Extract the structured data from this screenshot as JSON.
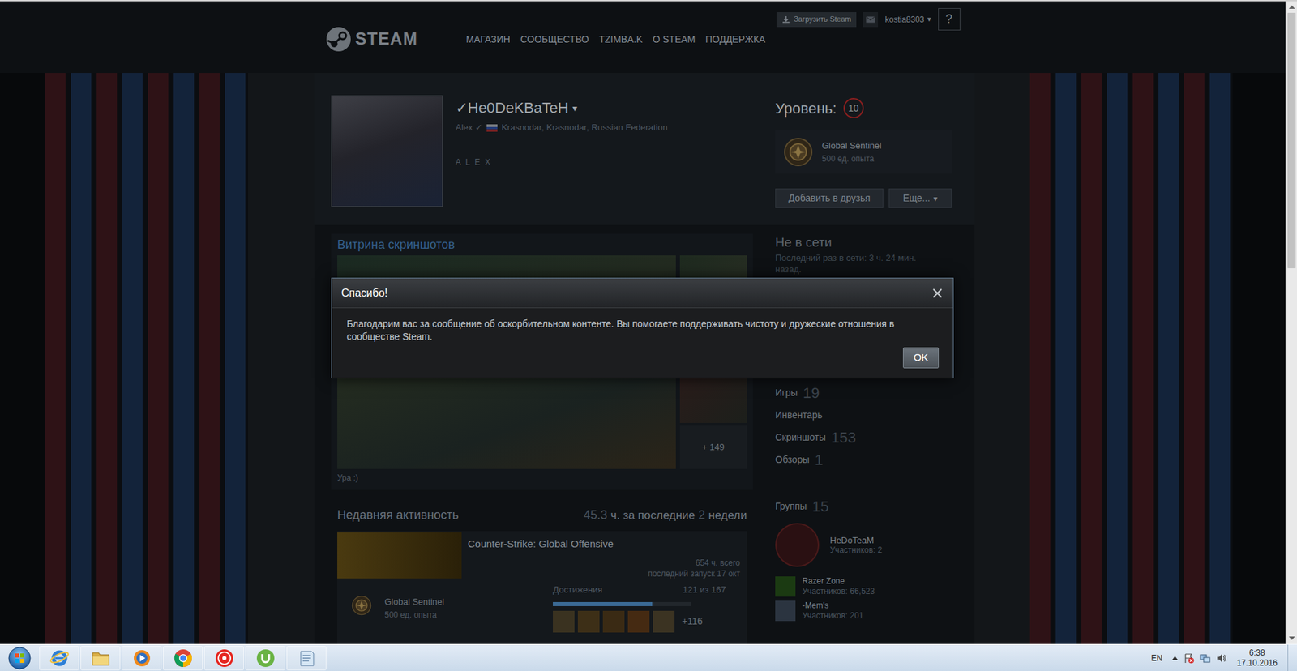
{
  "header": {
    "logo_text": "STEAM",
    "nav": [
      {
        "label": "МАГАЗИН"
      },
      {
        "label": "СООБЩЕСТВО"
      },
      {
        "label": "TZIMBA.K"
      },
      {
        "label": "О STEAM"
      },
      {
        "label": "ПОДДЕРЖКА"
      }
    ],
    "install_button": "Загрузить Steam",
    "account": "kostia8303",
    "account_caret": "▾",
    "help": "?"
  },
  "profile": {
    "name": "✓He0DeKBaTeH",
    "name_caret": "▾",
    "real_name": "Alex ✓",
    "location": "Krasnodar, Krasnodar, Russian Federation",
    "summary": "A L E X",
    "level_label": "Уровень:",
    "level": "10",
    "badge": {
      "name": "Global Sentinel",
      "xp": "500 ед. опыта"
    },
    "buttons": [
      {
        "label": "Добавить в друзья"
      },
      {
        "label": "Еще...",
        "caret": "▾"
      }
    ]
  },
  "screenshot_showcase": {
    "title": "Витрина скриншотов",
    "more": "+ 149",
    "caption": "Ура :)"
  },
  "recent_activity": {
    "title": "Недавняя активность",
    "hours": "45.3",
    "hours_label": "ч. за последние",
    "weeks": "2",
    "weeks_label": "недели",
    "games": [
      {
        "name": "Counter-Strike: Global Offensive",
        "total": "654 ч. всего",
        "last_played": "последний запуск 17 окт",
        "badge": {
          "name": "Global Sentinel",
          "xp": "500 ед. опыта"
        },
        "achievements": {
          "label": "Достижения",
          "count": "121 из 167",
          "level": 0.72,
          "more": "+116"
        }
      }
    ]
  },
  "status": {
    "state": "Не в сети",
    "last_online": "Последний раз в сети: 3 ч. 24 мин. назад."
  },
  "stats": [
    {
      "label": "Игры",
      "count": "19"
    },
    {
      "label": "Инвентарь"
    },
    {
      "label": "Скриншоты",
      "count": "153"
    },
    {
      "label": "Обзоры",
      "count": "1"
    }
  ],
  "groups": {
    "label": "Группы",
    "count": "15",
    "items": [
      {
        "name": "HeDoTeaM",
        "members": "Участников: 2",
        "kind": "featured"
      },
      {
        "name": "Razer Zone",
        "members": "Участников: 66,523",
        "kind": "compact"
      },
      {
        "name": "-Mem's",
        "members": "Участников: 201",
        "kind": "compact"
      }
    ]
  },
  "dialog": {
    "title": "Спасибо!",
    "message": "Благодарим вас за сообщение об оскорбительном контенте. Вы помогаете поддерживать чистоту и дружеские отношения в сообществе Steam.",
    "buttons": [
      "OK"
    ]
  },
  "taskbar": {
    "language": "EN",
    "time": "6:38",
    "date": "17.10.2016"
  }
}
